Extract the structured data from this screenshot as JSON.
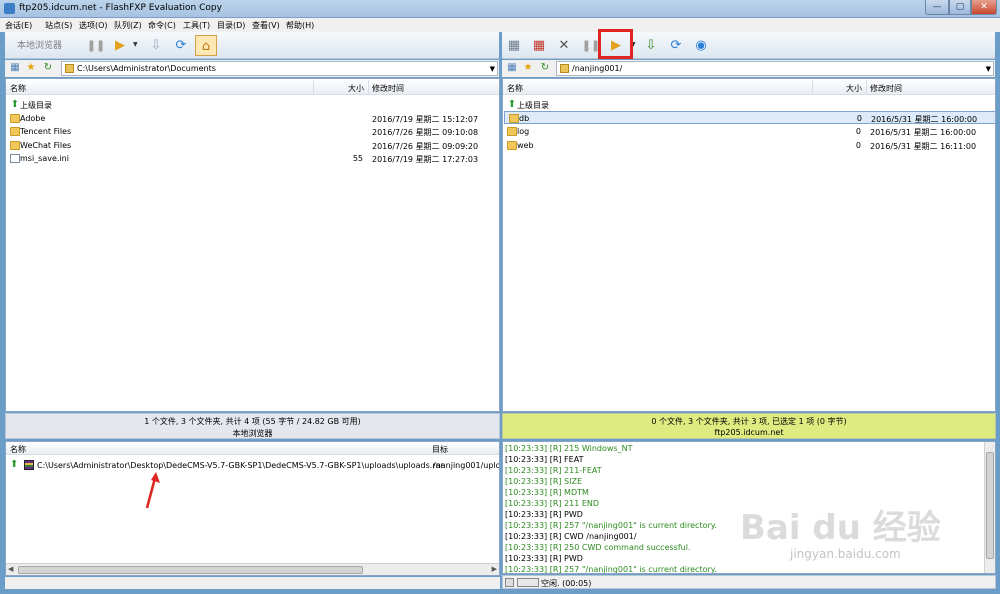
{
  "window": {
    "title": "ftp205.idcum.net - FlashFXP Evaluation Copy",
    "min_glyph": "—",
    "max_glyph": "▢",
    "close_glyph": "✕"
  },
  "menu": [
    "会话(E)",
    "站点(S)",
    "选项(O)",
    "队列(Z)",
    "命令(C)",
    "工具(T)",
    "目录(D)",
    "查看(V)",
    "帮助(H)"
  ],
  "left_toolbar": {
    "label": "本地浏览器"
  },
  "left_path": "C:\\Users\\Administrator\\Documents",
  "right_path": "/nanjing001/",
  "left_headers": {
    "name": "名称",
    "size": "大小",
    "date": "修改时间"
  },
  "right_headers": {
    "name": "名称",
    "size": "大小",
    "date": "修改时间"
  },
  "up_label": "上级目录",
  "left_files": [
    {
      "name": "Adobe",
      "size": "",
      "date": "2016/7/19 星期二 15:12:07",
      "type": "folder"
    },
    {
      "name": "Tencent Files",
      "size": "",
      "date": "2016/7/26 星期二 09:10:08",
      "type": "folder"
    },
    {
      "name": "WeChat Files",
      "size": "",
      "date": "2016/7/26 星期二 09:09:20",
      "type": "folder"
    },
    {
      "name": "msi_save.ini",
      "size": "55",
      "date": "2016/7/19 星期二 17:27:03",
      "type": "file"
    }
  ],
  "right_files": [
    {
      "name": "db",
      "size": "0",
      "date": "2016/5/31 星期二 16:00:00",
      "type": "folder"
    },
    {
      "name": "log",
      "size": "0",
      "date": "2016/5/31 星期二 16:00:00",
      "type": "folder"
    },
    {
      "name": "web",
      "size": "0",
      "date": "2016/5/31 星期二 16:11:00",
      "type": "folder"
    }
  ],
  "left_status": {
    "line1": "1 个文件, 3 个文件夹, 共计 4 项 (55 字节 / 24.82 GB 可用)",
    "line2": "本地浏览器"
  },
  "right_status": {
    "line1": "0 个文件, 3 个文件夹, 共计 3 项, 已选定 1 项 (0 字节)",
    "line2": "ftp205.idcum.net"
  },
  "queue": {
    "col_name": "名称",
    "col_target": "目标",
    "item_path": "C:\\Users\\Administrator\\Desktop\\DedeCMS-V5.7-GBK-SP1\\DedeCMS-V5.7-GBK-SP1\\uploads\\uploads.rar",
    "item_target": "/nanjing001/uploa"
  },
  "log": [
    {
      "text": "[10:23:33] [R] 215 Windows_NT",
      "color": "green"
    },
    {
      "text": "[10:23:33] [R] FEAT",
      "color": "black"
    },
    {
      "text": "[10:23:33] [R] 211-FEAT",
      "color": "green"
    },
    {
      "text": "[10:23:33] [R]      SIZE",
      "color": "green"
    },
    {
      "text": "[10:23:33] [R]      MDTM",
      "color": "green"
    },
    {
      "text": "[10:23:33] [R] 211 END",
      "color": "green"
    },
    {
      "text": "[10:23:33] [R] PWD",
      "color": "black"
    },
    {
      "text": "[10:23:33] [R] 257 \"/nanjing001\" is current directory.",
      "color": "green"
    },
    {
      "text": "[10:23:33] [R] CWD /nanjing001/",
      "color": "black"
    },
    {
      "text": "[10:23:33] [R] 250 CWD command successful.",
      "color": "green"
    },
    {
      "text": "[10:23:33] [R] PWD",
      "color": "black"
    },
    {
      "text": "[10:23:33] [R] 257 \"/nanjing001\" is current directory.",
      "color": "green"
    }
  ],
  "bottom_status": "空闲. (00:05)",
  "watermark": {
    "text": "Bai du 经验",
    "url": "jingyan.baidu.com"
  },
  "icons": {
    "pause": "❚❚",
    "play": "▶",
    "dropdown": "▼",
    "refresh": "⟳",
    "home": "⌂",
    "transfer": "⇩",
    "connect": "▦",
    "disconnect": "▦",
    "abort": "✕",
    "globe": "◉",
    "star": "★",
    "sync": "↻",
    "up_arrow": "⬆"
  },
  "colors": {
    "highlight": "#e0241f",
    "remote_status": "#ddeb80",
    "log_green": "#2d8a1f"
  }
}
